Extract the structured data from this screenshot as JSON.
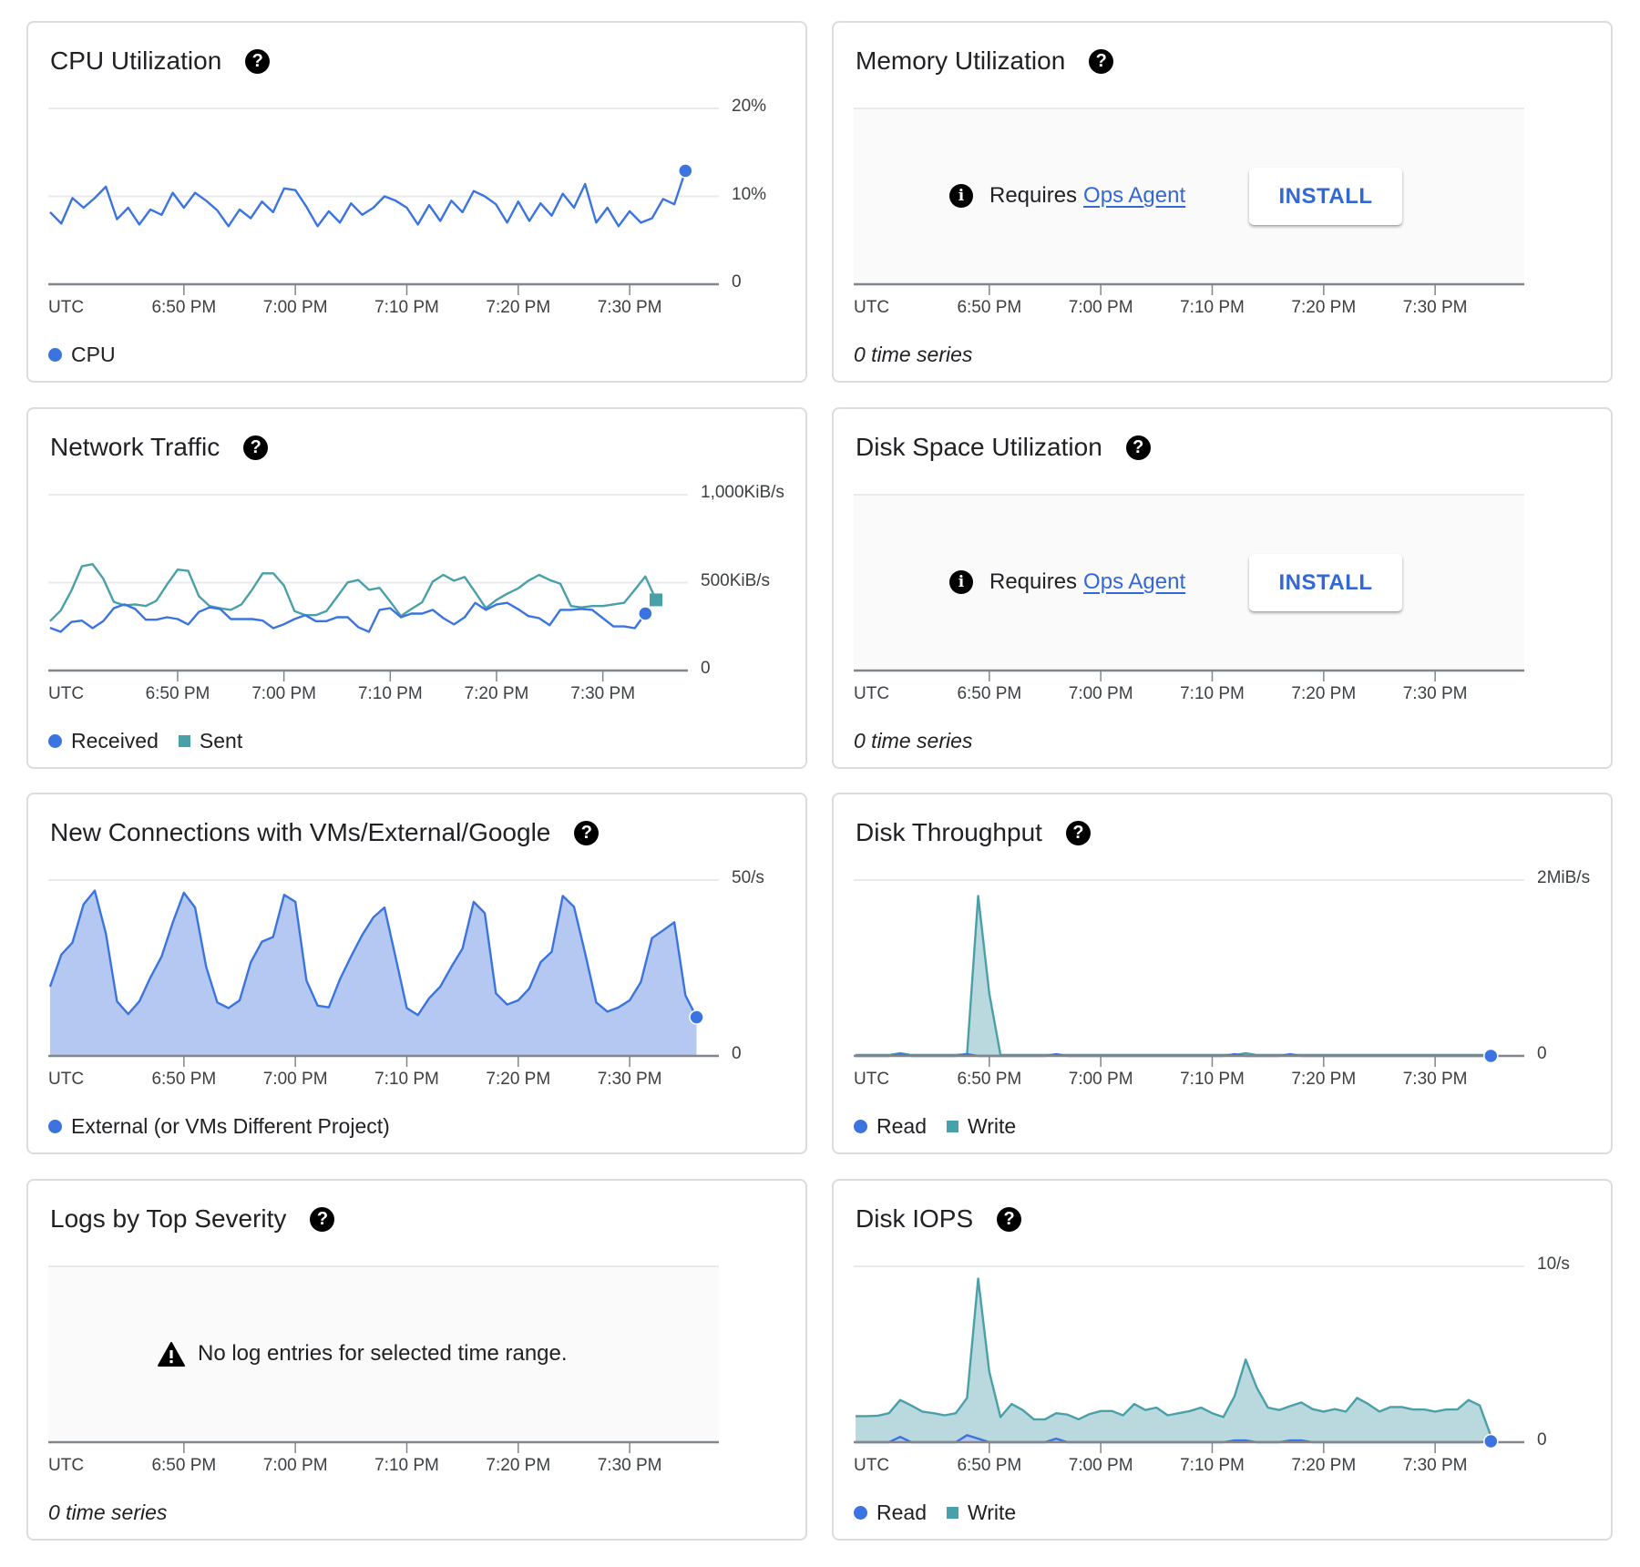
{
  "colors": {
    "blue": "#3b74e0",
    "blue_fill": "#b4c8f2",
    "teal": "#4aa0a8",
    "teal_fill": "#bad9df",
    "link": "#3367d6"
  },
  "help_icon": "help-circle-icon",
  "cards": [
    {
      "slug": "cpu-utilization",
      "title": "CPU Utilization",
      "chart": 0,
      "legend": true
    },
    {
      "slug": "memory-utilization",
      "title": "Memory Utilization",
      "chart": 1,
      "legend": false,
      "footnote": "0 time series",
      "empty_state": {
        "icon": "info-icon",
        "text": "Requires",
        "link": "Ops Agent",
        "button": "INSTALL"
      }
    },
    {
      "slug": "network-traffic",
      "title": "Network Traffic",
      "chart": 2,
      "legend": true
    },
    {
      "slug": "disk-space-utilization",
      "title": "Disk Space Utilization",
      "chart": 3,
      "legend": false,
      "footnote": "0 time series",
      "empty_state": {
        "icon": "info-icon",
        "text": "Requires",
        "link": "Ops Agent",
        "button": "INSTALL"
      }
    },
    {
      "slug": "new-connections",
      "title": "New Connections with VMs/External/Google",
      "chart": 4,
      "legend": true
    },
    {
      "slug": "disk-throughput",
      "title": "Disk Throughput",
      "chart": 5,
      "legend": true
    },
    {
      "slug": "logs-by-top-severity",
      "title": "Logs by Top Severity",
      "chart": 6,
      "legend": false,
      "footnote": "0 time series",
      "empty_state": {
        "icon": "warning-icon",
        "text": "No log entries for selected time range."
      }
    },
    {
      "slug": "disk-iops",
      "title": "Disk IOPS",
      "chart": 7,
      "legend": true
    }
  ],
  "chart_data": [
    {
      "type": "line",
      "title": "CPU Utilization",
      "x_axis_label": "UTC",
      "xlim": [
        "18:37:50",
        "19:38:00"
      ],
      "x_ticks": [
        {
          "t": "18:50",
          "label": "6:50 PM"
        },
        {
          "t": "19:00",
          "label": "7:00 PM"
        },
        {
          "t": "19:10",
          "label": "7:10 PM"
        },
        {
          "t": "19:20",
          "label": "7:20 PM"
        },
        {
          "t": "19:30",
          "label": "7:30 PM"
        }
      ],
      "ylim": [
        0,
        20
      ],
      "y_ticks": [
        {
          "v": 0,
          "label": "0"
        },
        {
          "v": 10,
          "label": "10%"
        },
        {
          "v": 20,
          "label": "20%"
        }
      ],
      "grid": true,
      "series": [
        {
          "name": "CPU",
          "color": "#3b74e0",
          "marker": "circle",
          "start": "18:38",
          "step_min": 1,
          "values": [
            8.2,
            6.9,
            9.8,
            8.7,
            9.8,
            11.1,
            7.4,
            8.7,
            6.8,
            8.5,
            7.9,
            10.4,
            8.7,
            10.4,
            9.5,
            8.4,
            6.6,
            8.5,
            7.5,
            9.4,
            8.2,
            10.9,
            10.7,
            8.8,
            6.6,
            8.3,
            7.0,
            9.2,
            7.9,
            8.7,
            10.0,
            9.5,
            8.7,
            6.8,
            9.0,
            7.2,
            9.5,
            8.2,
            10.6,
            10.0,
            9.1,
            7.0,
            9.4,
            7.2,
            9.2,
            7.8,
            10.3,
            8.7,
            11.4,
            7.0,
            8.7,
            6.6,
            8.3,
            7.0,
            7.5,
            9.7,
            9.1,
            12.9
          ]
        }
      ]
    },
    {
      "type": "line",
      "title": "Memory Utilization",
      "x_axis_label": "UTC",
      "xlim": [
        "18:37:50",
        "19:38:00"
      ],
      "x_ticks": [
        {
          "t": "18:50",
          "label": "6:50 PM"
        },
        {
          "t": "19:00",
          "label": "7:00 PM"
        },
        {
          "t": "19:10",
          "label": "7:10 PM"
        },
        {
          "t": "19:20",
          "label": "7:20 PM"
        },
        {
          "t": "19:30",
          "label": "7:30 PM"
        }
      ],
      "ylim": [
        0,
        1
      ],
      "y_ticks": [],
      "grid": true,
      "series": []
    },
    {
      "type": "line",
      "title": "Network Traffic",
      "x_axis_label": "UTC",
      "xlim": [
        "18:37:50",
        "19:38:00"
      ],
      "x_ticks": [
        {
          "t": "18:50",
          "label": "6:50 PM"
        },
        {
          "t": "19:00",
          "label": "7:00 PM"
        },
        {
          "t": "19:10",
          "label": "7:10 PM"
        },
        {
          "t": "19:20",
          "label": "7:20 PM"
        },
        {
          "t": "19:30",
          "label": "7:30 PM"
        }
      ],
      "ylim": [
        0,
        1000
      ],
      "y_ticks": [
        {
          "v": 0,
          "label": "0"
        },
        {
          "v": 500,
          "label": "500KiB/s"
        },
        {
          "v": 1000,
          "label": "1,000KiB/s"
        }
      ],
      "grid": true,
      "series": [
        {
          "name": "Received",
          "color": "#3b74e0",
          "marker": "circle",
          "start": "18:38",
          "step_min": 1,
          "values": [
            243,
            220,
            276,
            284,
            241,
            281,
            355,
            376,
            350,
            289,
            289,
            303,
            293,
            262,
            333,
            359,
            350,
            293,
            293,
            293,
            284,
            241,
            263,
            293,
            315,
            281,
            281,
            303,
            303,
            246,
            220,
            345,
            355,
            303,
            324,
            324,
            345,
            298,
            262,
            303,
            385,
            345,
            376,
            385,
            350,
            310,
            298,
            258,
            345,
            345,
            350,
            345,
            298,
            251,
            251,
            241,
            324
          ]
        },
        {
          "name": "Sent",
          "color": "#4aa0a8",
          "marker": "square",
          "start": "18:38",
          "step_min": 1,
          "values": [
            281,
            341,
            454,
            593,
            605,
            523,
            390,
            371,
            376,
            367,
            397,
            489,
            574,
            567,
            423,
            367,
            354,
            345,
            376,
            459,
            553,
            553,
            484,
            338,
            315,
            315,
            338,
            419,
            501,
            515,
            459,
            470,
            393,
            310,
            350,
            388,
            506,
            544,
            511,
            532,
            445,
            355,
            402,
            437,
            466,
            511,
            544,
            515,
            494,
            367,
            359,
            367,
            367,
            376,
            385,
            459,
            535,
            402
          ]
        }
      ]
    },
    {
      "type": "line",
      "title": "Disk Space Utilization",
      "x_axis_label": "UTC",
      "xlim": [
        "18:37:50",
        "19:38:00"
      ],
      "x_ticks": [
        {
          "t": "18:50",
          "label": "6:50 PM"
        },
        {
          "t": "19:00",
          "label": "7:00 PM"
        },
        {
          "t": "19:10",
          "label": "7:10 PM"
        },
        {
          "t": "19:20",
          "label": "7:20 PM"
        },
        {
          "t": "19:30",
          "label": "7:30 PM"
        }
      ],
      "ylim": [
        0,
        1
      ],
      "y_ticks": [],
      "grid": true,
      "series": []
    },
    {
      "type": "area",
      "title": "New Connections with VMs/External/Google",
      "x_axis_label": "UTC",
      "xlim": [
        "18:37:50",
        "19:38:00"
      ],
      "x_ticks": [
        {
          "t": "18:50",
          "label": "6:50 PM"
        },
        {
          "t": "19:00",
          "label": "7:00 PM"
        },
        {
          "t": "19:10",
          "label": "7:10 PM"
        },
        {
          "t": "19:20",
          "label": "7:20 PM"
        },
        {
          "t": "19:30",
          "label": "7:30 PM"
        }
      ],
      "ylim": [
        0,
        50
      ],
      "y_ticks": [
        {
          "v": 0,
          "label": "0"
        },
        {
          "v": 50,
          "label": "50/s"
        }
      ],
      "grid": true,
      "series": [
        {
          "name": "External (or VMs Different Project)",
          "color": "#3b74e0",
          "fill": "#b4c8f2",
          "marker": "circle",
          "start": "18:38",
          "step_min": 1,
          "values": [
            19.7,
            28.8,
            32.2,
            43.1,
            47.0,
            34.8,
            15.5,
            11.9,
            15.5,
            22.3,
            28.3,
            37.9,
            46.4,
            42.2,
            25.3,
            15.2,
            13.6,
            15.8,
            26.6,
            32.5,
            33.8,
            45.8,
            43.8,
            21.4,
            14.3,
            13.8,
            21.8,
            28.3,
            34.4,
            39.4,
            42.2,
            27.9,
            13.6,
            11.6,
            16.4,
            19.7,
            25.3,
            30.5,
            43.8,
            40.6,
            17.8,
            14.6,
            15.8,
            19.2,
            26.6,
            29.6,
            45.5,
            42.4,
            29.2,
            15.2,
            12.6,
            13.8,
            15.8,
            21.0,
            33.5,
            35.7,
            38.0,
            17.2,
            11.0
          ]
        }
      ]
    },
    {
      "type": "area",
      "title": "Disk Throughput",
      "x_axis_label": "UTC",
      "xlim": [
        "18:37:50",
        "19:38:00"
      ],
      "x_ticks": [
        {
          "t": "18:50",
          "label": "6:50 PM"
        },
        {
          "t": "19:00",
          "label": "7:00 PM"
        },
        {
          "t": "19:10",
          "label": "7:10 PM"
        },
        {
          "t": "19:20",
          "label": "7:20 PM"
        },
        {
          "t": "19:30",
          "label": "7:30 PM"
        }
      ],
      "ylim": [
        0,
        2
      ],
      "y_unit": "MiB/s",
      "y_ticks": [
        {
          "v": 0,
          "label": "0"
        },
        {
          "v": 2,
          "label": "2MiB/s"
        }
      ],
      "grid": true,
      "series": [
        {
          "name": "Read",
          "color": "#3b74e0",
          "fill": "#b4c8f2",
          "marker": "circle",
          "start": "18:38",
          "step_min": 1,
          "values": [
            0,
            0,
            0,
            0,
            0.02,
            0,
            0,
            0,
            0,
            0,
            0.02,
            0,
            0,
            0,
            0,
            0,
            0,
            0,
            0.02,
            0,
            0,
            0,
            0,
            0,
            0,
            0,
            0,
            0,
            0,
            0,
            0,
            0,
            0,
            0,
            0.02,
            0,
            0,
            0,
            0,
            0.02,
            0,
            0,
            0,
            0,
            0,
            0,
            0,
            0,
            0,
            0,
            0,
            0,
            0,
            0,
            0,
            0,
            0,
            0
          ]
        },
        {
          "name": "Write",
          "color": "#4aa0a8",
          "fill": "#bad9df",
          "marker": "square",
          "start": "18:38",
          "step_min": 1,
          "values": [
            0.01,
            0.01,
            0.01,
            0.01,
            0.03,
            0.01,
            0.01,
            0.01,
            0.01,
            0.01,
            0.02,
            1.82,
            0.71,
            0.01,
            0.01,
            0.01,
            0.01,
            0.01,
            0.01,
            0.01,
            0.01,
            0.01,
            0.01,
            0.01,
            0.01,
            0.01,
            0.01,
            0.01,
            0.01,
            0.01,
            0.01,
            0.01,
            0.01,
            0.01,
            0.01,
            0.03,
            0.01,
            0.01,
            0.01,
            0.01,
            0.01,
            0.01,
            0.01,
            0.01,
            0.01,
            0.01,
            0.01,
            0.01,
            0.01,
            0.01,
            0.01,
            0.01,
            0.01,
            0.01,
            0.01,
            0.01,
            0.01,
            0.01
          ]
        }
      ]
    },
    {
      "type": "line",
      "title": "Logs by Top Severity",
      "x_axis_label": "UTC",
      "xlim": [
        "18:37:50",
        "19:38:00"
      ],
      "x_ticks": [
        {
          "t": "18:50",
          "label": "6:50 PM"
        },
        {
          "t": "19:00",
          "label": "7:00 PM"
        },
        {
          "t": "19:10",
          "label": "7:10 PM"
        },
        {
          "t": "19:20",
          "label": "7:20 PM"
        },
        {
          "t": "19:30",
          "label": "7:30 PM"
        }
      ],
      "ylim": [
        0,
        1
      ],
      "y_ticks": [],
      "grid": true,
      "series": []
    },
    {
      "type": "area",
      "title": "Disk IOPS",
      "x_axis_label": "UTC",
      "xlim": [
        "18:37:50",
        "19:38:00"
      ],
      "x_ticks": [
        {
          "t": "18:50",
          "label": "6:50 PM"
        },
        {
          "t": "19:00",
          "label": "7:00 PM"
        },
        {
          "t": "19:10",
          "label": "7:10 PM"
        },
        {
          "t": "19:20",
          "label": "7:20 PM"
        },
        {
          "t": "19:30",
          "label": "7:30 PM"
        }
      ],
      "ylim": [
        0,
        10
      ],
      "y_ticks": [
        {
          "v": 0,
          "label": "0"
        },
        {
          "v": 10,
          "label": "10/s"
        }
      ],
      "grid": true,
      "series": [
        {
          "name": "Read",
          "color": "#3b74e0",
          "fill": "#b4c8f2",
          "marker": "circle",
          "start": "18:38",
          "step_min": 1,
          "values": [
            0,
            0,
            0,
            0,
            0.3,
            0,
            0,
            0,
            0,
            0,
            0.4,
            0.2,
            0,
            0,
            0,
            0,
            0,
            0,
            0.2,
            0,
            0,
            0,
            0,
            0,
            0,
            0,
            0,
            0,
            0,
            0,
            0,
            0,
            0,
            0,
            0.1,
            0.1,
            0,
            0,
            0,
            0.1,
            0.1,
            0,
            0,
            0,
            0,
            0,
            0,
            0,
            0,
            0,
            0,
            0,
            0,
            0,
            0,
            0,
            0,
            0.05
          ]
        },
        {
          "name": "Write",
          "color": "#4aa0a8",
          "fill": "#bad9df",
          "marker": "square",
          "start": "18:38",
          "step_min": 1,
          "values": [
            1.48,
            1.48,
            1.51,
            1.65,
            2.4,
            2.09,
            1.74,
            1.65,
            1.53,
            1.65,
            2.52,
            9.3,
            4.0,
            1.43,
            2.17,
            1.83,
            1.3,
            1.3,
            1.65,
            1.57,
            1.3,
            1.6,
            1.77,
            1.77,
            1.53,
            2.17,
            1.83,
            1.97,
            1.53,
            1.65,
            1.77,
            1.97,
            1.65,
            1.43,
            2.61,
            4.7,
            3.1,
            1.97,
            1.83,
            2.05,
            2.26,
            1.88,
            1.74,
            1.88,
            1.74,
            2.52,
            2.17,
            1.74,
            2.0,
            2.0,
            1.86,
            1.86,
            1.74,
            1.86,
            1.86,
            2.4,
            2.09,
            0.35
          ]
        }
      ]
    }
  ]
}
